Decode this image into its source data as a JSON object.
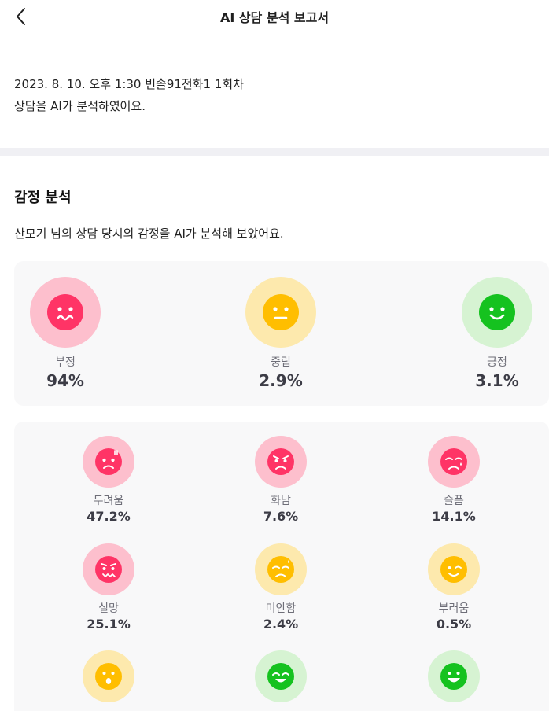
{
  "header": {
    "title": "AI 상담 분석 보고서",
    "back_icon": "chevron-left-icon"
  },
  "intro": {
    "line1": "2023. 8. 10. 오후 1:30 빈솔91전화1 1회차",
    "line2": "상담을 AI가 분석하였어요."
  },
  "emotion": {
    "title": "감정 분석",
    "description": "산모기 님의 상담 당시의 감정을 AI가 분석해 보았어요.",
    "summary": [
      {
        "label": "부정",
        "value": "94%",
        "icon": "worried-face-icon"
      },
      {
        "label": "중립",
        "value": "2.9%",
        "icon": "neutral-face-icon"
      },
      {
        "label": "긍정",
        "value": "3.1%",
        "icon": "smiling-face-icon"
      }
    ],
    "details": [
      {
        "label": "두려움",
        "value": "47.2%",
        "icon": "fearful-face-icon"
      },
      {
        "label": "화남",
        "value": "7.6%",
        "icon": "angry-face-icon"
      },
      {
        "label": "슬픔",
        "value": "14.1%",
        "icon": "sad-face-icon"
      },
      {
        "label": "실망",
        "value": "25.1%",
        "icon": "disappointed-face-icon"
      },
      {
        "label": "미안함",
        "value": "2.4%",
        "icon": "sorry-face-icon"
      },
      {
        "label": "부러움",
        "value": "0.5%",
        "icon": "envious-face-icon"
      },
      {
        "label": "",
        "value": "",
        "icon": "surprised-face-icon"
      },
      {
        "label": "",
        "value": "",
        "icon": "happy-face-icon"
      },
      {
        "label": "",
        "value": "",
        "icon": "joyful-face-icon"
      }
    ]
  },
  "colors": {
    "negative": "#ff3466",
    "negative_halo": "#fdbfcd",
    "neutral": "#ffbe00",
    "neutral_halo": "#fde9ad",
    "positive": "#15c21f",
    "positive_halo": "#d6f3d2",
    "divider": "#f0f0f4",
    "card_bg": "#f8f8f9"
  }
}
